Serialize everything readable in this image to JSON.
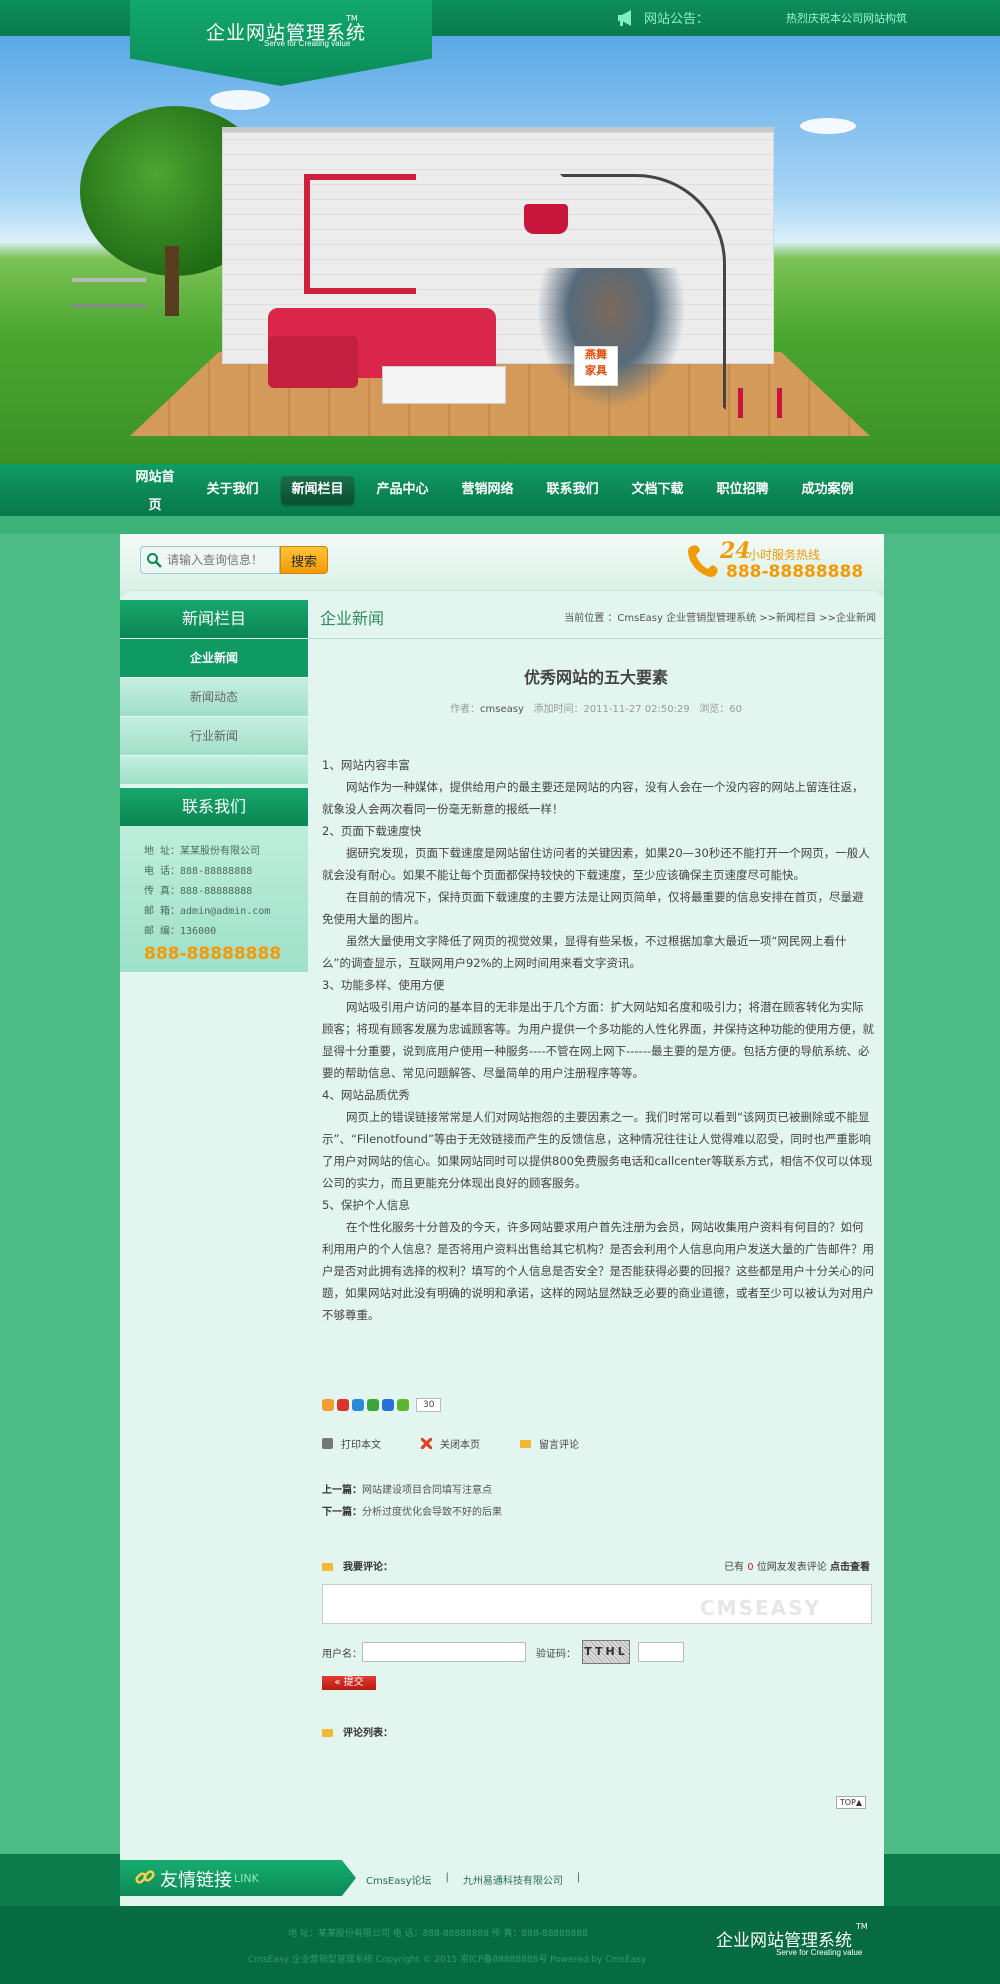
{
  "header": {
    "logo_title": "企业网站管理系统",
    "logo_tm": "TM",
    "logo_sub": "Serve for Creating value",
    "notice_label": "网站公告：",
    "notice_text": "热烈庆祝本公司网站构筑"
  },
  "banner": {
    "sign_text_1": "燕舞",
    "sign_text_2": "家具"
  },
  "nav": {
    "items": [
      {
        "label": "网站首页"
      },
      {
        "label": "关于我们"
      },
      {
        "label": "新闻栏目"
      },
      {
        "label": "产品中心"
      },
      {
        "label": "营销网络"
      },
      {
        "label": "联系我们"
      },
      {
        "label": "文档下载"
      },
      {
        "label": "职位招聘"
      },
      {
        "label": "成功案例"
      }
    ],
    "active_index": 2
  },
  "search": {
    "placeholder": "请输入查询信息！",
    "button": "搜索"
  },
  "hotline": {
    "num24": "24",
    "label": "小时服务热线",
    "number": "888-88888888"
  },
  "sidebar": {
    "title": "新闻栏目",
    "items": [
      {
        "label": "企业新闻"
      },
      {
        "label": "新闻动态"
      },
      {
        "label": "行业新闻"
      }
    ],
    "contact_title": "联系我们",
    "contact": {
      "address": "地 址：某某股份有限公司",
      "tel": "电 话：888-88888888",
      "fax": "传 真：888-88888888",
      "email": "邮 箱：admin@admin.com",
      "zip": "邮 编：136000",
      "phone": "888-88888888"
    }
  },
  "main": {
    "section_title": "企业新闻",
    "breadcrumb": "当前位置 ：CmsEasy 企业营销型管理系统 >>新闻栏目 >>企业新闻",
    "article": {
      "title": "优秀网站的五大要素",
      "author_label": "作者：",
      "author": "cmseasy",
      "time_label": "添加时间：",
      "time": "2011-11-27 02:50:29",
      "views_label": "浏览：",
      "views": "60",
      "body": [
        {
          "indent": false,
          "text": "1、网站内容丰富"
        },
        {
          "indent": true,
          "text": "网站作为一种媒体，提供给用户的最主要还是网站的内容，没有人会在一个没内容的网站上留连往返，就象没人会两次看同一份毫无新意的报纸一样！"
        },
        {
          "indent": false,
          "text": "2、页面下载速度快"
        },
        {
          "indent": true,
          "text": "据研究发现，页面下载速度是网站留住访问者的关键因素，如果20—30秒还不能打开一个网页，一般人就会没有耐心。如果不能让每个页面都保持较快的下载速度，至少应该确保主页速度尽可能快。"
        },
        {
          "indent": true,
          "text": "在目前的情况下，保持页面下载速度的主要方法是让网页简单，仅将最重要的信息安排在首页，尽量避免使用大量的图片。"
        },
        {
          "indent": true,
          "text": "虽然大量使用文字降低了网页的视觉效果，显得有些呆板，不过根据加拿大最近一项“网民网上看什么”的调查显示，互联网用户92%的上网时间用来看文字资讯。"
        },
        {
          "indent": false,
          "text": "3、功能多样、使用方便"
        },
        {
          "indent": true,
          "text": "网站吸引用户访问的基本目的无非是出于几个方面：扩大网站知名度和吸引力；将潜在顾客转化为实际顾客；将现有顾客发展为忠诚顾客等。为用户提供一个多功能的人性化界面，并保持这种功能的使用方便，就显得十分重要，说到底用户使用一种服务----不管在网上网下------最主要的是方便。包括方便的导航系统、必要的帮助信息、常见问题解答、尽量简单的用户注册程序等等。"
        },
        {
          "indent": false,
          "text": "4、网站品质优秀"
        },
        {
          "indent": true,
          "text": "网页上的错误链接常常是人们对网站抱怨的主要因素之一。我们时常可以看到“该网页已被删除或不能显示”、“Filenotfound”等由于无效链接而产生的反馈信息，这种情况往往让人觉得难以忍受，同时也严重影响了用户对网站的信心。如果网站同时可以提供800免费服务电话和callcenter等联系方式，相信不仅可以体现公司的实力，而且更能充分体现出良好的顾客服务。"
        },
        {
          "indent": false,
          "text": "5、保护个人信息"
        },
        {
          "indent": true,
          "text": "在个性化服务十分普及的今天，许多网站要求用户首先注册为会员，网站收集用户资料有何目的？如何利用用户的个人信息？是否将用户资料出售给其它机构？是否会利用个人信息向用户发送大量的广告邮件？用户是否对此拥有选择的权利？填写的个人信息是否安全？是否能获得必要的回报？这些都是用户十分关心的问题，如果网站对此没有明确的说明和承诺，这样的网站显然缺乏必要的商业道德，或者至少可以被认为对用户不够尊重。"
        }
      ]
    },
    "share_count": "30",
    "tools": {
      "print": "打印本文",
      "close": "关闭本页",
      "comment": "留言评论"
    },
    "prev_label": "上一篇：",
    "prev_title": "网站建设项目合同填写注意点",
    "next_label": "下一篇：",
    "next_title": "分析过度优化会导致不好的后果",
    "comment": {
      "title": "我要评论：",
      "count_prefix": "已有",
      "count": "0",
      "count_suffix": "位网友发表评论",
      "view_link": "点击查看",
      "watermark": "CMSEASY",
      "username_label": "用户名：",
      "captcha_label": "验证码：",
      "captcha_text": "TTHL",
      "submit": "« 提交",
      "list_title": "评论列表："
    },
    "top_btn": "TOP▲"
  },
  "links": {
    "title": "友情链接",
    "title_en": "LINK",
    "items": [
      {
        "label": "CmsEasy论坛"
      },
      {
        "label": "九州易通科技有限公司"
      }
    ],
    "sep": "|"
  },
  "footer": {
    "line1": "地 址：某某股份有限公司   电 话：888-88888888   传 真：888-88888888",
    "line2": "CmsEasy 企业营销型管理系统 Copyright © 2015   京ICP备88888888号   Powered by CmsEasy",
    "logo_title": "企业网站管理系统",
    "logo_tm": "TM",
    "logo_sub": "Serve for Creating value"
  },
  "colors": {
    "brand": "#0b8a58",
    "accent": "#f29a07",
    "page_bg": "#4dbb86"
  }
}
